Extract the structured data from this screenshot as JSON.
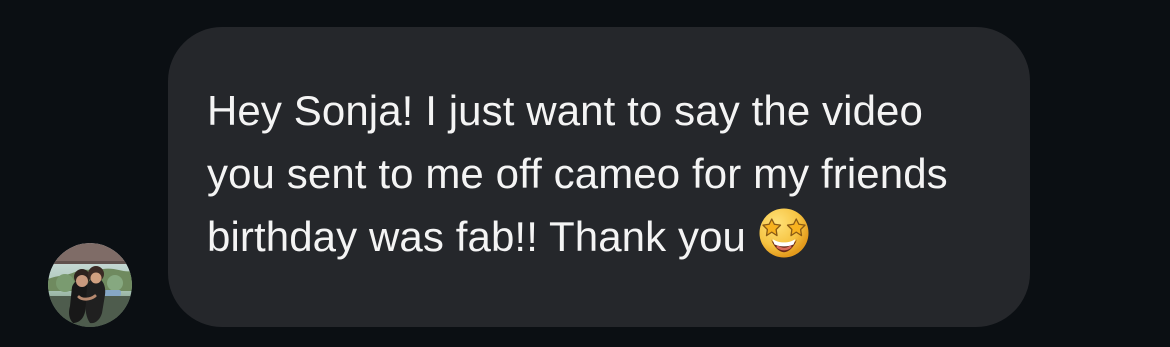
{
  "conversation": {
    "incoming_message": {
      "text": "Hey Sonja! I just want to say the video you sent to me off cameo for my friends birthday was fab!! Thank you",
      "emoji": "star-struck-icon"
    },
    "sender": {
      "avatar": "profile-photo"
    }
  },
  "colors": {
    "background": "#0b0f13",
    "bubble": "#25272b",
    "text": "#f4f4f4",
    "emoji": "#f6c443"
  }
}
